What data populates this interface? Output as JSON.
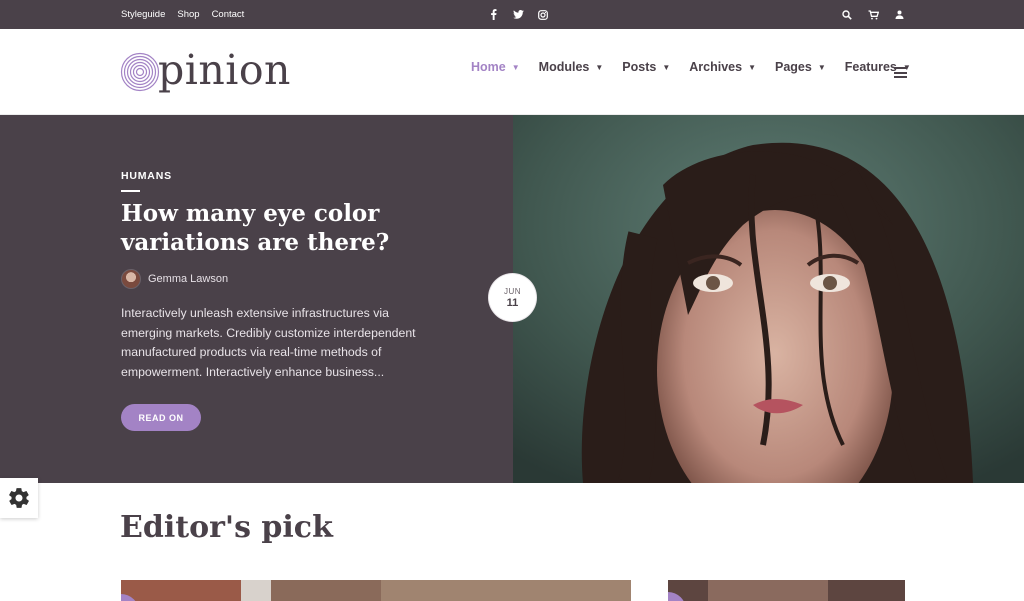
{
  "topbar": {
    "links": [
      "Styleguide",
      "Shop",
      "Contact"
    ],
    "social_icons": [
      "facebook-icon",
      "twitter-icon",
      "instagram-icon"
    ],
    "tool_icons": [
      "search-icon",
      "cart-icon",
      "user-icon"
    ]
  },
  "header": {
    "logo_text": "pinion",
    "nav": [
      {
        "label": "Home",
        "active": true
      },
      {
        "label": "Modules",
        "active": false
      },
      {
        "label": "Posts",
        "active": false
      },
      {
        "label": "Archives",
        "active": false
      },
      {
        "label": "Pages",
        "active": false
      },
      {
        "label": "Features",
        "active": false
      }
    ],
    "caret": "▼"
  },
  "hero": {
    "category": "HUMANS",
    "title": "How many eye color variations are there?",
    "author": "Gemma Lawson",
    "excerpt": "Interactively unleash extensive infrastructures via emerging markets. Credibly customize interdependent manufactured products via real-time methods of empowerment. Interactively enhance business...",
    "cta": "READ ON",
    "date": {
      "month": "JUN",
      "day": "11"
    }
  },
  "section": {
    "title": "Editor's pick"
  },
  "colors": {
    "accent": "#a383c5",
    "dark": "#4a4149"
  }
}
